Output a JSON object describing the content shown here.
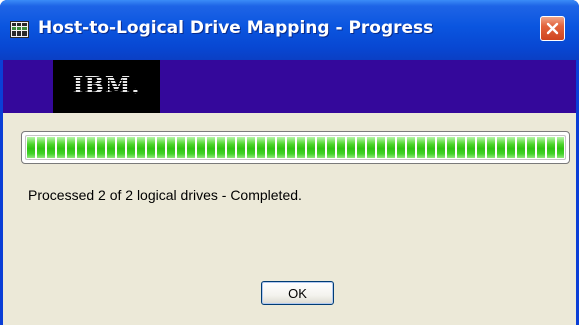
{
  "window": {
    "title": "Host-to-Logical Drive Mapping - Progress"
  },
  "banner": {
    "logo_text": "IBM."
  },
  "progress": {
    "fraction": 1.0
  },
  "status": {
    "message": "Processed 2 of 2 logical drives - Completed."
  },
  "buttons": {
    "ok_label": "OK"
  },
  "colors": {
    "titlebar": "#0a55df",
    "banner": "#34089b",
    "progress_fill": "#2fc312",
    "dialog_background": "#ece9d8"
  },
  "icons": {
    "app": "app-window-icon",
    "close": "close-icon"
  }
}
